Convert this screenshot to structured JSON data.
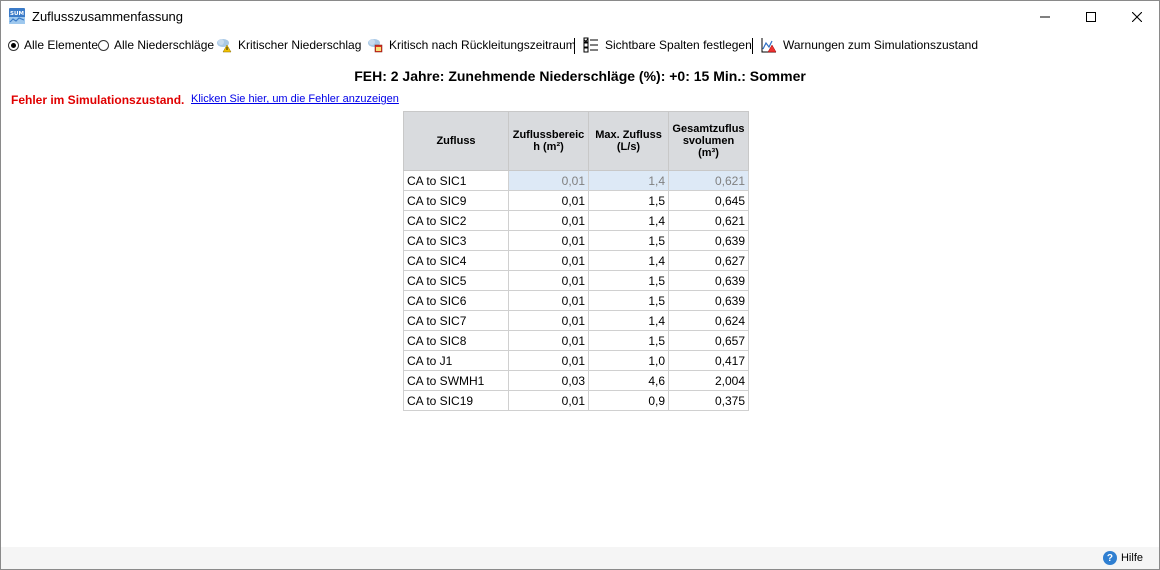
{
  "window": {
    "title": "Zuflusszusammenfassung",
    "app_icon_text": "SUM",
    "minimize_icon": "minimize-icon",
    "maximize_icon": "maximize-icon",
    "close_icon": "close-icon"
  },
  "toolbar": {
    "radio_all_elements": "Alle Elemente",
    "radio_all_rainfall": "Alle Niederschläge",
    "critical_rainfall": "Kritischer Niederschlag",
    "critical_by_return": "Kritisch nach Rückleitungszeitraum",
    "visible_columns": "Sichtbare Spalten festlegen",
    "warnings": "Warnungen zum Simulationszustand",
    "selected_radio": "Alle Elemente"
  },
  "heading": "FEH: 2 Jahre: Zunehmende Niederschläge (%): +0: 15 Min.: Sommer",
  "error": {
    "label": "Fehler im Simulationszustand.",
    "link": "Klicken Sie hier, um die Fehler anzuzeigen",
    "color": "#e00000"
  },
  "table": {
    "headers": [
      {
        "line1": "Zufluss",
        "line2": ""
      },
      {
        "line1": "Zuflussbereic",
        "line2": "h (m²)"
      },
      {
        "line1": "Max. Zufluss",
        "line2": "(L/s)"
      },
      {
        "line1": "Gesamtzuflus",
        "line2": "svolumen (m³)"
      }
    ],
    "rows": [
      [
        "CA to SIC1",
        "0,01",
        "1,4",
        "0,621"
      ],
      [
        "CA to SIC9",
        "0,01",
        "1,5",
        "0,645"
      ],
      [
        "CA to SIC2",
        "0,01",
        "1,4",
        "0,621"
      ],
      [
        "CA to SIC3",
        "0,01",
        "1,5",
        "0,639"
      ],
      [
        "CA to SIC4",
        "0,01",
        "1,4",
        "0,627"
      ],
      [
        "CA to SIC5",
        "0,01",
        "1,5",
        "0,639"
      ],
      [
        "CA to SIC6",
        "0,01",
        "1,5",
        "0,639"
      ],
      [
        "CA to SIC7",
        "0,01",
        "1,4",
        "0,624"
      ],
      [
        "CA to SIC8",
        "0,01",
        "1,5",
        "0,657"
      ],
      [
        "CA to J1",
        "0,01",
        "1,0",
        "0,417"
      ],
      [
        "CA to SWMH1",
        "0,03",
        "4,6",
        "2,004"
      ],
      [
        "CA to SIC19",
        "0,01",
        "0,9",
        "0,375"
      ]
    ],
    "selected_row": 0
  },
  "footer": {
    "help_label": "Hilfe",
    "help_icon_glyph": "?"
  }
}
